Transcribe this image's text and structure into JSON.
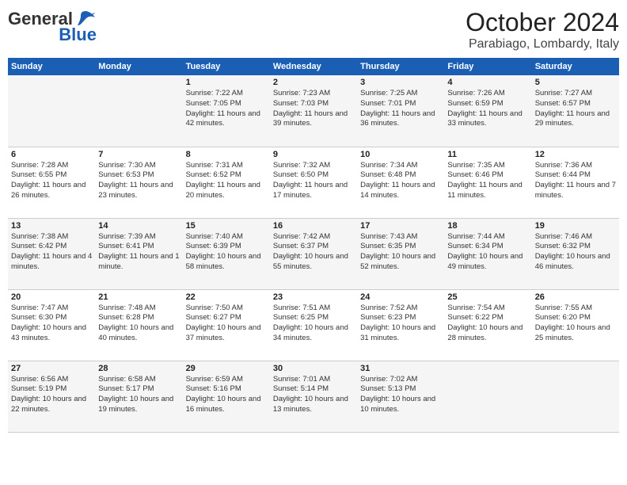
{
  "header": {
    "logo_line1": "General",
    "logo_line2": "Blue",
    "month": "October 2024",
    "location": "Parabiago, Lombardy, Italy"
  },
  "weekdays": [
    "Sunday",
    "Monday",
    "Tuesday",
    "Wednesday",
    "Thursday",
    "Friday",
    "Saturday"
  ],
  "weeks": [
    [
      {
        "day": "",
        "info": ""
      },
      {
        "day": "",
        "info": ""
      },
      {
        "day": "1",
        "info": "Sunrise: 7:22 AM\nSunset: 7:05 PM\nDaylight: 11 hours and 42 minutes."
      },
      {
        "day": "2",
        "info": "Sunrise: 7:23 AM\nSunset: 7:03 PM\nDaylight: 11 hours and 39 minutes."
      },
      {
        "day": "3",
        "info": "Sunrise: 7:25 AM\nSunset: 7:01 PM\nDaylight: 11 hours and 36 minutes."
      },
      {
        "day": "4",
        "info": "Sunrise: 7:26 AM\nSunset: 6:59 PM\nDaylight: 11 hours and 33 minutes."
      },
      {
        "day": "5",
        "info": "Sunrise: 7:27 AM\nSunset: 6:57 PM\nDaylight: 11 hours and 29 minutes."
      }
    ],
    [
      {
        "day": "6",
        "info": "Sunrise: 7:28 AM\nSunset: 6:55 PM\nDaylight: 11 hours and 26 minutes."
      },
      {
        "day": "7",
        "info": "Sunrise: 7:30 AM\nSunset: 6:53 PM\nDaylight: 11 hours and 23 minutes."
      },
      {
        "day": "8",
        "info": "Sunrise: 7:31 AM\nSunset: 6:52 PM\nDaylight: 11 hours and 20 minutes."
      },
      {
        "day": "9",
        "info": "Sunrise: 7:32 AM\nSunset: 6:50 PM\nDaylight: 11 hours and 17 minutes."
      },
      {
        "day": "10",
        "info": "Sunrise: 7:34 AM\nSunset: 6:48 PM\nDaylight: 11 hours and 14 minutes."
      },
      {
        "day": "11",
        "info": "Sunrise: 7:35 AM\nSunset: 6:46 PM\nDaylight: 11 hours and 11 minutes."
      },
      {
        "day": "12",
        "info": "Sunrise: 7:36 AM\nSunset: 6:44 PM\nDaylight: 11 hours and 7 minutes."
      }
    ],
    [
      {
        "day": "13",
        "info": "Sunrise: 7:38 AM\nSunset: 6:42 PM\nDaylight: 11 hours and 4 minutes."
      },
      {
        "day": "14",
        "info": "Sunrise: 7:39 AM\nSunset: 6:41 PM\nDaylight: 11 hours and 1 minute."
      },
      {
        "day": "15",
        "info": "Sunrise: 7:40 AM\nSunset: 6:39 PM\nDaylight: 10 hours and 58 minutes."
      },
      {
        "day": "16",
        "info": "Sunrise: 7:42 AM\nSunset: 6:37 PM\nDaylight: 10 hours and 55 minutes."
      },
      {
        "day": "17",
        "info": "Sunrise: 7:43 AM\nSunset: 6:35 PM\nDaylight: 10 hours and 52 minutes."
      },
      {
        "day": "18",
        "info": "Sunrise: 7:44 AM\nSunset: 6:34 PM\nDaylight: 10 hours and 49 minutes."
      },
      {
        "day": "19",
        "info": "Sunrise: 7:46 AM\nSunset: 6:32 PM\nDaylight: 10 hours and 46 minutes."
      }
    ],
    [
      {
        "day": "20",
        "info": "Sunrise: 7:47 AM\nSunset: 6:30 PM\nDaylight: 10 hours and 43 minutes."
      },
      {
        "day": "21",
        "info": "Sunrise: 7:48 AM\nSunset: 6:28 PM\nDaylight: 10 hours and 40 minutes."
      },
      {
        "day": "22",
        "info": "Sunrise: 7:50 AM\nSunset: 6:27 PM\nDaylight: 10 hours and 37 minutes."
      },
      {
        "day": "23",
        "info": "Sunrise: 7:51 AM\nSunset: 6:25 PM\nDaylight: 10 hours and 34 minutes."
      },
      {
        "day": "24",
        "info": "Sunrise: 7:52 AM\nSunset: 6:23 PM\nDaylight: 10 hours and 31 minutes."
      },
      {
        "day": "25",
        "info": "Sunrise: 7:54 AM\nSunset: 6:22 PM\nDaylight: 10 hours and 28 minutes."
      },
      {
        "day": "26",
        "info": "Sunrise: 7:55 AM\nSunset: 6:20 PM\nDaylight: 10 hours and 25 minutes."
      }
    ],
    [
      {
        "day": "27",
        "info": "Sunrise: 6:56 AM\nSunset: 5:19 PM\nDaylight: 10 hours and 22 minutes."
      },
      {
        "day": "28",
        "info": "Sunrise: 6:58 AM\nSunset: 5:17 PM\nDaylight: 10 hours and 19 minutes."
      },
      {
        "day": "29",
        "info": "Sunrise: 6:59 AM\nSunset: 5:16 PM\nDaylight: 10 hours and 16 minutes."
      },
      {
        "day": "30",
        "info": "Sunrise: 7:01 AM\nSunset: 5:14 PM\nDaylight: 10 hours and 13 minutes."
      },
      {
        "day": "31",
        "info": "Sunrise: 7:02 AM\nSunset: 5:13 PM\nDaylight: 10 hours and 10 minutes."
      },
      {
        "day": "",
        "info": ""
      },
      {
        "day": "",
        "info": ""
      }
    ]
  ]
}
